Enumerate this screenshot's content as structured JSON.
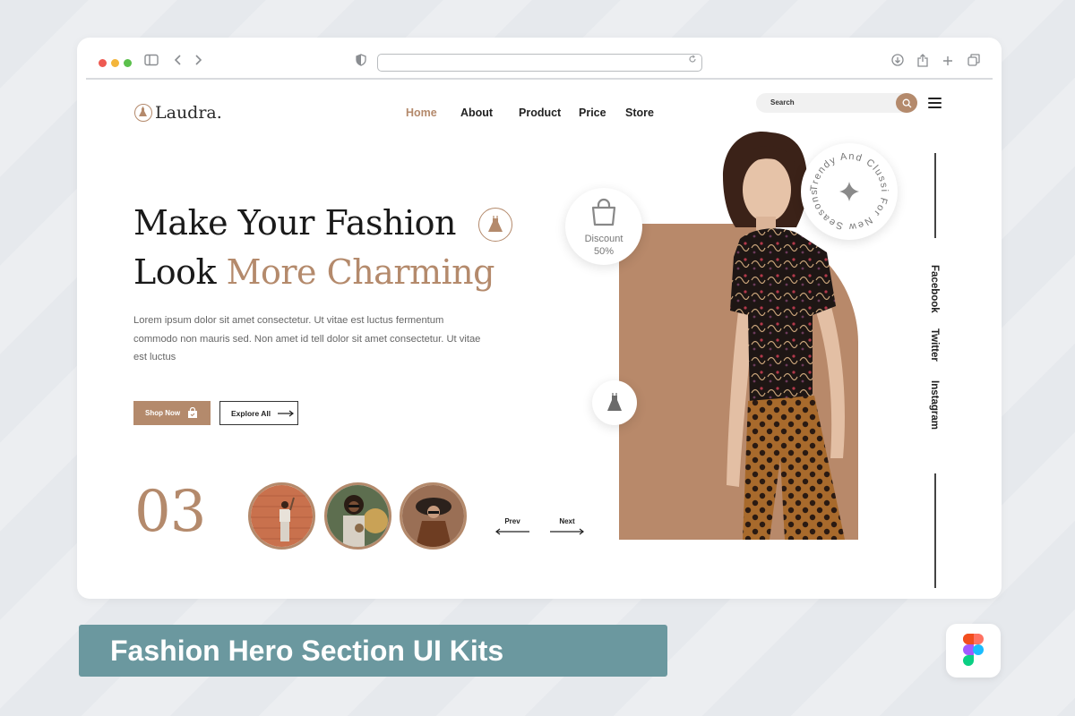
{
  "browser": {
    "sidebar_icon": "sidebar-icon",
    "back_icon": "chevron-left-icon",
    "forward_icon": "chevron-right-icon",
    "shield_icon": "shield-icon",
    "reload_icon": "reload-icon",
    "download_icon": "download-icon",
    "share_icon": "share-icon",
    "new_tab_icon": "plus-icon",
    "tabs_icon": "tabs-icon",
    "url": ""
  },
  "header": {
    "logo_text": "Laudra.",
    "nav": [
      {
        "label": "Home",
        "active": true
      },
      {
        "label": "About",
        "active": false
      },
      {
        "label": "Product",
        "active": false
      },
      {
        "label": "Price",
        "active": false
      },
      {
        "label": "Store",
        "active": false
      }
    ],
    "search_placeholder": "Search",
    "search_icon": "search-icon",
    "menu_icon": "menu-icon"
  },
  "hero": {
    "headline_line1": "Make Your Fashion",
    "headline_line2_plain": "Look ",
    "headline_line2_accent": "More Charming",
    "description": "Lorem ipsum dolor sit amet consectetur. Ut vitae est luctus fermentum commodo non mauris sed. Non amet id tell  dolor sit amet consectetur. Ut vitae est luctus",
    "shop_button": "Shop Now",
    "explore_button": "Explore All",
    "count": "03",
    "prev_label": "Prev",
    "next_label": "Next"
  },
  "promo": {
    "discount_label": "Discount",
    "discount_value": "50%",
    "seal_text": "Trendy And Clussi For New Seasons"
  },
  "social": [
    "Facebook",
    "Twitter",
    "Instagram"
  ],
  "caption": "Fashion Hero Section UI Kits",
  "colors": {
    "accent": "#b48a6c",
    "caption_bg": "#6b989f",
    "text_dark": "#1a1a1a"
  }
}
